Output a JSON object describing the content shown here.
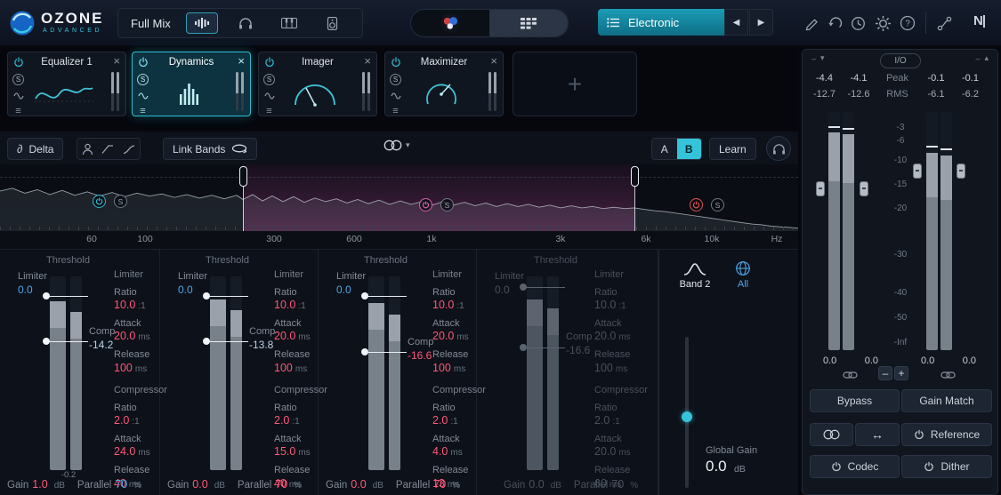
{
  "colors": {
    "bg": "#06080d",
    "accent_teal": "#35c3da",
    "accent_pink": "#ff5878",
    "accent_blue": "#4da6e8",
    "meter_fill": "#788089"
  },
  "header": {
    "logo_title": "OZONE",
    "logo_sub": "ADVANCED",
    "source": "Full Mix",
    "preset": "Electronic",
    "ni_logo": "N|"
  },
  "chain": {
    "solo": "S",
    "cards": [
      {
        "title": "Equalizer 1"
      },
      {
        "title": "Dynamics"
      },
      {
        "title": "Imager"
      },
      {
        "title": "Maximizer"
      }
    ]
  },
  "toolbar": {
    "delta": "Delta",
    "link_bands": "Link Bands",
    "ab_a": "A",
    "ab_b": "B",
    "learn": "Learn"
  },
  "spectrum": {
    "solo": "S",
    "freqs": [
      "60",
      "100",
      "300",
      "600",
      "1k",
      "3k",
      "6k",
      "10k"
    ],
    "unit": "Hz"
  },
  "bands": [
    {
      "threshold": "Threshold",
      "limiter": "Limiter",
      "limiter_value": "0.0",
      "comp": "Comp",
      "comp_value": "-14.2",
      "limiter_header": "Limiter",
      "ratio": "Ratio",
      "ratio_value": "10.0",
      "ratio_unit": ":1",
      "attack": "Attack",
      "attack_value": "20.0",
      "attack_unit": "ms",
      "release": "Release",
      "release_value": "100",
      "release_unit": "ms",
      "comp_header": "Compressor",
      "ratio2": "Ratio",
      "comp_ratio_value": "2.0",
      "comp_ratio_unit": ":1",
      "attack2": "Attack",
      "comp_attack_value": "24.0",
      "comp_attack_unit": "ms",
      "release2": "Release",
      "comp_release_value": "40",
      "comp_release_unit": "ms",
      "gr": "-0.2",
      "gain": "Gain",
      "gain_value": "1.0",
      "gain_unit": "dB",
      "parallel": "Parallel",
      "parallel_value": "70",
      "parallel_unit": "%"
    },
    {
      "threshold": "Threshold",
      "limiter": "Limiter",
      "limiter_value": "0.0",
      "comp": "Comp",
      "comp_value": "-13.8",
      "limiter_header": "Limiter",
      "ratio": "Ratio",
      "ratio_value": "10.0",
      "ratio_unit": ":1",
      "attack": "Attack",
      "attack_value": "20.0",
      "attack_unit": "ms",
      "release": "Release",
      "release_value": "100",
      "release_unit": "ms",
      "comp_header": "Compressor",
      "ratio2": "Ratio",
      "comp_ratio_value": "2.0",
      "comp_ratio_unit": ":1",
      "attack2": "Attack",
      "comp_attack_value": "15.0",
      "comp_attack_unit": "ms",
      "release2": "Release",
      "comp_release_value": "40",
      "comp_release_unit": "ms",
      "gr": "",
      "gain": "Gain",
      "gain_value": "0.0",
      "gain_unit": "dB",
      "parallel": "Parallel",
      "parallel_value": "70",
      "parallel_unit": "%"
    },
    {
      "threshold": "Threshold",
      "limiter": "Limiter",
      "limiter_value": "0.0",
      "comp": "Comp",
      "comp_value": "-16.6",
      "limiter_header": "Limiter",
      "ratio": "Ratio",
      "ratio_value": "10.0",
      "ratio_unit": ":1",
      "attack": "Attack",
      "attack_value": "20.0",
      "attack_unit": "ms",
      "release": "Release",
      "release_value": "100",
      "release_unit": "ms",
      "comp_header": "Compressor",
      "ratio2": "Ratio",
      "comp_ratio_value": "2.0",
      "comp_ratio_unit": ":1",
      "attack2": "Attack",
      "comp_attack_value": "4.0",
      "comp_attack_unit": "ms",
      "release2": "Release",
      "comp_release_value": "13",
      "comp_release_unit": "ms",
      "gr": "",
      "gain": "Gain",
      "gain_value": "0.0",
      "gain_unit": "dB",
      "parallel": "Parallel",
      "parallel_value": "70",
      "parallel_unit": "%"
    },
    {
      "threshold": "Threshold",
      "limiter": "Limiter",
      "limiter_value": "0.0",
      "comp": "Comp",
      "comp_value": "-16.6",
      "limiter_header": "Limiter",
      "ratio": "Ratio",
      "ratio_value": "10.0",
      "ratio_unit": ":1",
      "attack": "Attack",
      "attack_value": "20.0",
      "attack_unit": "ms",
      "release": "Release",
      "release_value": "100",
      "release_unit": "ms",
      "comp_header": "Compressor",
      "ratio2": "Ratio",
      "comp_ratio_value": "2.0",
      "comp_ratio_unit": ":1",
      "attack2": "Attack",
      "comp_attack_value": "20.0",
      "comp_attack_unit": "ms",
      "release2": "Release",
      "comp_release_value": "60",
      "comp_release_unit": "ms",
      "gr": "",
      "gain": "Gain",
      "gain_value": "0.0",
      "gain_unit": "dB",
      "parallel": "Parallel",
      "parallel_value": "70",
      "parallel_unit": "%"
    }
  ],
  "global_panel": {
    "band": "Band 2",
    "all": "All",
    "gain_label": "Global Gain",
    "gain_value": "0.0",
    "gain_unit": "dB"
  },
  "io": {
    "label": "I/O",
    "peak": "Peak",
    "rms": "RMS",
    "peak_in_l": "-4.4",
    "peak_in_r": "-4.1",
    "peak_out_l": "-0.1",
    "peak_out_r": "-0.1",
    "rms_in_l": "-12.7",
    "rms_in_r": "-12.6",
    "rms_out_l": "-6.1",
    "rms_out_r": "-6.2",
    "scale": [
      "-3",
      "-6",
      "-10",
      "-15",
      "-20",
      "-30",
      "-40",
      "-50",
      "-Inf"
    ],
    "gain_in_l": "0.0",
    "gain_in_r": "0.0",
    "gain_out_l": "0.0",
    "gain_out_r": "0.0",
    "bypass": "Bypass",
    "gain_match": "Gain Match",
    "reference": "Reference",
    "codec": "Codec",
    "dither": "Dither"
  }
}
